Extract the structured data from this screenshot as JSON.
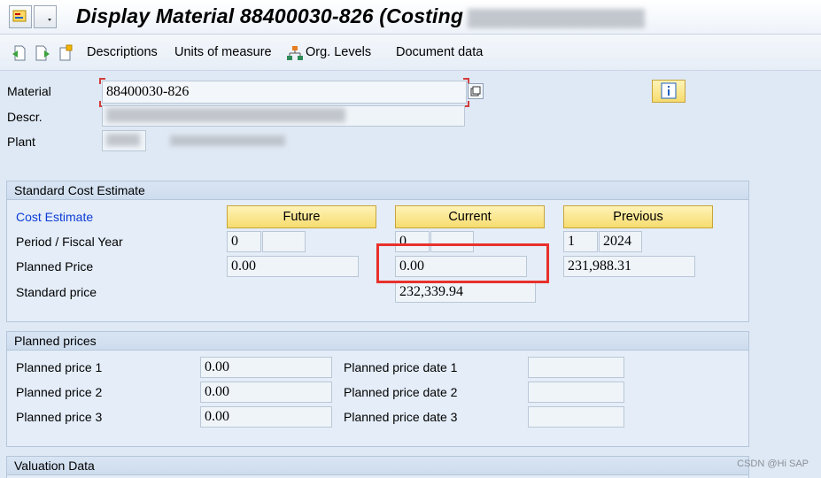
{
  "header": {
    "title": "Display Material 88400030-826 (Costing"
  },
  "toolbar": {
    "items": [
      "Descriptions",
      "Units of measure",
      "Org. Levels",
      "Document data"
    ]
  },
  "material": {
    "material_label": "Material",
    "material_value": "88400030-826",
    "descr_label": "Descr.",
    "plant_label": "Plant"
  },
  "std_cost": {
    "title": "Standard Cost Estimate",
    "cost_estimate_link": "Cost Estimate",
    "columns": [
      "Future",
      "Current",
      "Previous"
    ],
    "period_label": "Period / Fiscal Year",
    "planned_label": "Planned Price",
    "standard_label": "Standard price",
    "future": {
      "period": "0",
      "year": "",
      "planned": "0.00"
    },
    "current": {
      "period": "0",
      "year": "",
      "planned": "0.00",
      "standard": "232,339.94"
    },
    "previous": {
      "period": "1",
      "year": "2024",
      "planned": "231,988.31"
    }
  },
  "planned_prices": {
    "title": "Planned prices",
    "rows": [
      {
        "label": "Planned price 1",
        "value": "0.00",
        "date_label": "Planned price date 1",
        "date": ""
      },
      {
        "label": "Planned price 2",
        "value": "0.00",
        "date_label": "Planned price date 2",
        "date": ""
      },
      {
        "label": "Planned price 3",
        "value": "0.00",
        "date_label": "Planned price date 3",
        "date": ""
      }
    ]
  },
  "valuation": {
    "title": "Valuation Data"
  },
  "watermark": "CSDN @Hi SAP",
  "colors": {
    "accent_button": "#f6dc6e",
    "highlight": "#e8312a",
    "link": "#0b3cd6"
  },
  "icons": [
    "menu-icon",
    "dropdown-icon",
    "prev-icon",
    "next-icon",
    "copy-icon",
    "org-levels-icon",
    "info-icon",
    "copy-field-icon"
  ]
}
